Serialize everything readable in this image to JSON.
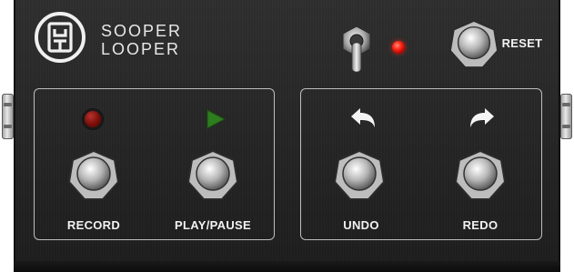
{
  "brand": {
    "line1": "SOOPER",
    "line2": "LOOPER"
  },
  "reset": {
    "label": "RESET"
  },
  "buttons": {
    "record": {
      "label": "RECORD"
    },
    "play_pause": {
      "label": "PLAY/PAUSE"
    },
    "undo": {
      "label": "UNDO"
    },
    "redo": {
      "label": "REDO"
    }
  },
  "icons": {
    "logo": "sooper-looper-logo",
    "toggle": "toggle-switch",
    "status_led": "red-led",
    "record_led": "dark-red-led",
    "play": "green-play-triangle",
    "undo": "curved-arrow-left",
    "redo": "curved-arrow-right"
  },
  "colors": {
    "status_led": "#ff2a1a",
    "record_led": "#7e0e0a",
    "play": "#2e7d1e",
    "text": "#f2f2f2"
  }
}
